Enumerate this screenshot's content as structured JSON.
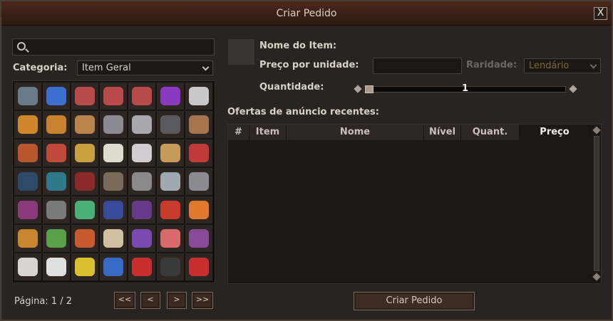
{
  "window": {
    "title": "Criar Pedido",
    "close_label": "X"
  },
  "left": {
    "search": {
      "placeholder": "",
      "value": ""
    },
    "category_label": "Categoria:",
    "category_value": "Item Geral",
    "items": [
      {
        "name": "rope-icon",
        "color": "#6a7a86"
      },
      {
        "name": "blueberry-icon",
        "color": "#3e6ed0"
      },
      {
        "name": "npc-figure-icon",
        "color": "#b84a4a"
      },
      {
        "name": "npc-figure-icon",
        "color": "#b84a4a"
      },
      {
        "name": "npc-figure-icon",
        "color": "#b84a4a"
      },
      {
        "name": "purple-dice-icon",
        "color": "#8a3ac0"
      },
      {
        "name": "skull-figure-icon",
        "color": "#c8c8c8"
      },
      {
        "name": "gourd-icon",
        "color": "#d0862a"
      },
      {
        "name": "treasure-chest-icon",
        "color": "#c8822e"
      },
      {
        "name": "leather-icon",
        "color": "#b8844c"
      },
      {
        "name": "ore-icon",
        "color": "#8a8a90"
      },
      {
        "name": "ore-icon",
        "color": "#a8a8ae"
      },
      {
        "name": "coal-icon",
        "color": "#5a5a5e"
      },
      {
        "name": "planks-icon",
        "color": "#a87450"
      },
      {
        "name": "logs-icon",
        "color": "#b8562e"
      },
      {
        "name": "logs-icon",
        "color": "#c04a3a"
      },
      {
        "name": "logs-icon",
        "color": "#c8a040"
      },
      {
        "name": "cotton-icon",
        "color": "#e0dad0"
      },
      {
        "name": "cotton-icon",
        "color": "#d0ccd0"
      },
      {
        "name": "yarn-icon",
        "color": "#c89a58"
      },
      {
        "name": "yarn-icon",
        "color": "#c03a3a"
      },
      {
        "name": "dye-pile-icon",
        "color": "#2e4a6a"
      },
      {
        "name": "dye-pile-icon",
        "color": "#2e7a8a"
      },
      {
        "name": "dye-pile-icon",
        "color": "#8a2a2a"
      },
      {
        "name": "stone-orb-icon",
        "color": "#7a6a5a"
      },
      {
        "name": "stone-orb-icon",
        "color": "#8a8a8a"
      },
      {
        "name": "bone-icon",
        "color": "#a0a8b0"
      },
      {
        "name": "spyglass-icon",
        "color": "#8a8a90"
      },
      {
        "name": "fruit-icon",
        "color": "#8a3a7a"
      },
      {
        "name": "fruit-icon",
        "color": "#7a7a7a"
      },
      {
        "name": "mushroom-icon",
        "color": "#4ab07a"
      },
      {
        "name": "battery-icon",
        "color": "#3a4a9a"
      },
      {
        "name": "battery-icon",
        "color": "#6a3a8a"
      },
      {
        "name": "potion-icon",
        "color": "#c83a2e"
      },
      {
        "name": "scroll-icon",
        "color": "#e0782e"
      },
      {
        "name": "npc-head-icon",
        "color": "#c8862e"
      },
      {
        "name": "npc-head-icon",
        "color": "#5aa04a"
      },
      {
        "name": "npc-head-icon",
        "color": "#c85a2e"
      },
      {
        "name": "gift-creature-icon",
        "color": "#d0c0a0"
      },
      {
        "name": "gift-creature-icon",
        "color": "#7a4ab0"
      },
      {
        "name": "gift-creature-icon",
        "color": "#d86a6a"
      },
      {
        "name": "npc-head-icon",
        "color": "#8a4a9a"
      },
      {
        "name": "horn-icon",
        "color": "#d8d4d0"
      },
      {
        "name": "helmet-icon",
        "color": "#e0e0e0"
      },
      {
        "name": "horn-icon",
        "color": "#d8c02e"
      },
      {
        "name": "horn-icon",
        "color": "#3a6ac8"
      },
      {
        "name": "horn-icon",
        "color": "#c82e2e"
      },
      {
        "name": "horn-icon",
        "color": "#3a3a3a"
      },
      {
        "name": "horn-icon",
        "color": "#c82e2e"
      }
    ],
    "page_label": "Página: 1 / 2",
    "nav": {
      "first": "<<",
      "prev": "<",
      "next": ">",
      "last": ">>"
    }
  },
  "right": {
    "item_name_label": "Nome do Item:",
    "unit_price_label": "Preço por unidade:",
    "unit_price_value": "",
    "rarity_label": "Raridade:",
    "rarity_value": "Lendário",
    "quantity_label": "Quantidade:",
    "quantity_value": "1",
    "recent_label": "Ofertas de anúncio recentes:",
    "columns": [
      "#",
      "Item",
      "Nome",
      "Nível",
      "Quant.",
      "Preço"
    ],
    "submit": "Criar Pedido"
  }
}
